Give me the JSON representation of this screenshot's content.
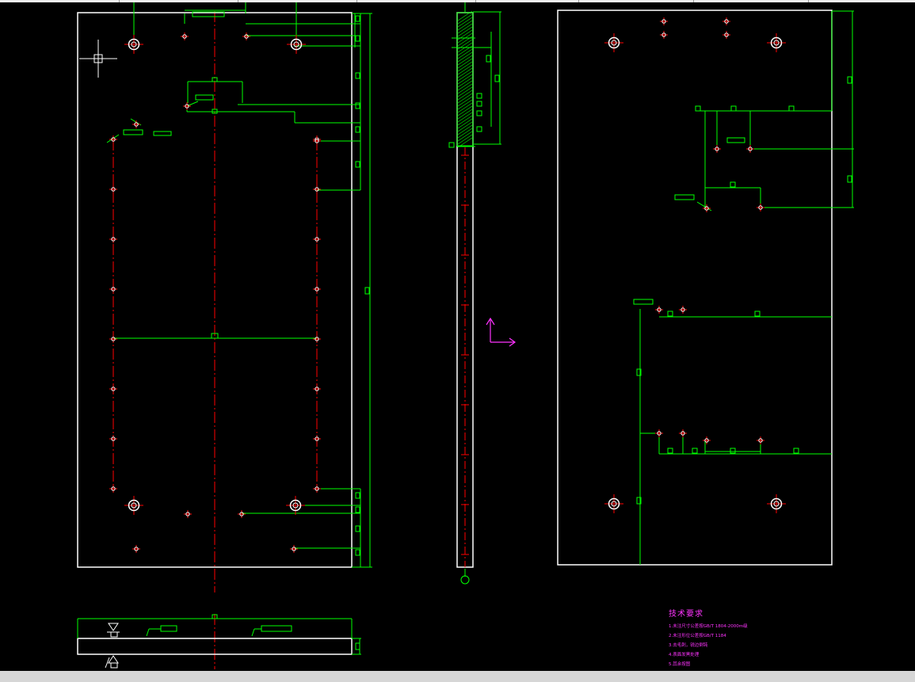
{
  "colors": {
    "background": "#000000",
    "outline": "#ffffff",
    "dimension": "#00ff00",
    "centerline": "#ff0000",
    "annotation": "#ff33ff"
  },
  "technical_requirements": {
    "title": "技术要求",
    "lines": [
      "1.未注尺寸公差按GB/T 1804-2000m级",
      "2.未注形位公差按GB/T 1184",
      "3.去毛刺，锐边倒钝",
      "4.表面发黑处理",
      "5.其余按图"
    ]
  },
  "icons": [
    "ucs-axis-icon",
    "crosshair-cursor-icon",
    "section-symbol-icon",
    "surface-symbol-icon"
  ]
}
